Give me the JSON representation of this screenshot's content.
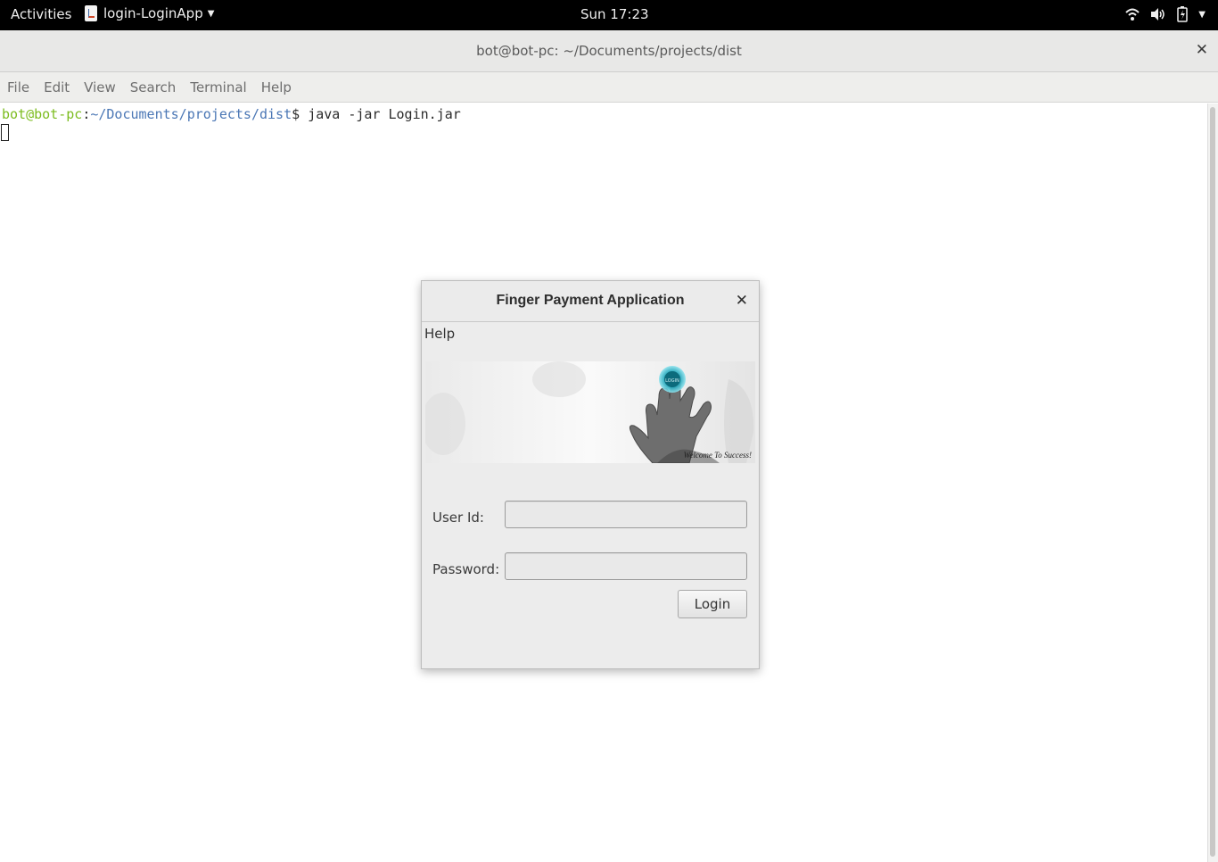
{
  "topbar": {
    "activities": "Activities",
    "app_name": "login-LoginApp",
    "clock": "Sun 17:23"
  },
  "terminal": {
    "title": "bot@bot-pc: ~/Documents/projects/dist",
    "menu": [
      "File",
      "Edit",
      "View",
      "Search",
      "Terminal",
      "Help"
    ],
    "prompt_user": "bot@bot-pc",
    "prompt_sep": ":",
    "prompt_path": "~/Documents/projects/dist",
    "prompt_symbol": "$ ",
    "command": "java -jar Login.jar"
  },
  "dialog": {
    "title": "Finger Payment Application",
    "menu_help": "Help",
    "banner_text": "Welcome To Success!",
    "user_id_label": "User Id:",
    "user_id_value": "",
    "password_label": "Password:",
    "password_value": "",
    "login_label": "Login"
  },
  "colors": {
    "prompt_user": "#7cbc1f",
    "prompt_path": "#4b77b5",
    "topbar_bg": "#000000"
  },
  "icons": [
    "java-app-icon",
    "caret-down-icon",
    "wifi-icon",
    "volume-icon",
    "battery-icon",
    "power-menu-icon",
    "close-icon",
    "login-fingerprint-icon"
  ]
}
